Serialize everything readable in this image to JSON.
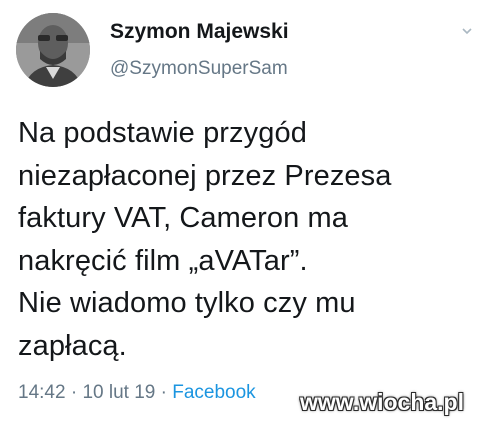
{
  "author": {
    "display_name": "Szymon Majewski",
    "handle": "@SzymonSuperSam",
    "avatar_icon": "person-portrait-avatar"
  },
  "tweet": {
    "lines": [
      "Na podstawie przygód",
      "niezapłaconej przez Prezesa",
      "faktury VAT, Cameron ma",
      "nakręcić film „aVATar”.",
      "Nie wiadomo tylko czy mu",
      "zapłacą."
    ]
  },
  "meta": {
    "time": "14:42",
    "separator": "·",
    "date": "10 lut 19",
    "source": "Facebook"
  },
  "watermark": "www.wiocha.pl",
  "menu_icon": "chevron-down-icon",
  "colors": {
    "text": "#14171a",
    "secondary": "#657786",
    "link": "#1b95e0"
  }
}
